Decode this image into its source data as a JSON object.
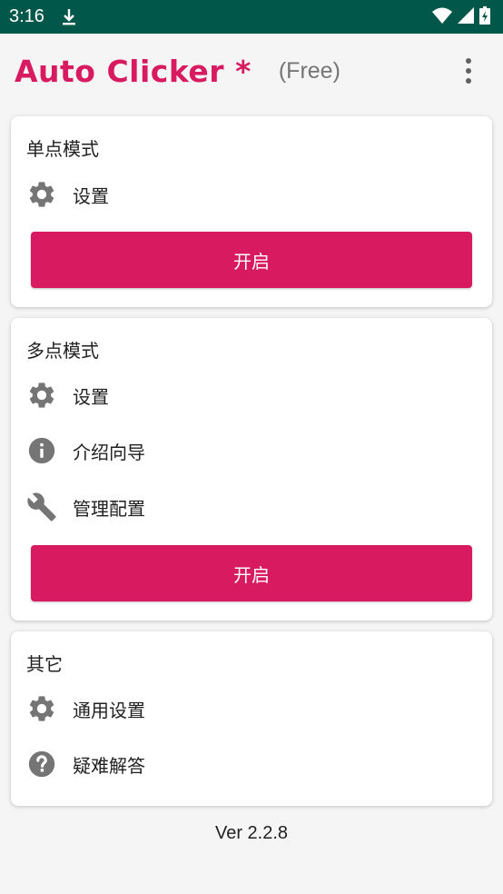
{
  "status_bar": {
    "time": "3:16",
    "icons": [
      "download-icon",
      "wifi-icon",
      "signal-icon",
      "battery-icon"
    ]
  },
  "app_bar": {
    "title": "Auto Clicker *",
    "subtitle": "(Free)",
    "menu_icon": "more-vert-icon"
  },
  "single_mode": {
    "title": "单点模式",
    "items": [
      {
        "icon": "gear-icon",
        "label": "设置"
      }
    ],
    "start_label": "开启"
  },
  "multi_mode": {
    "title": "多点模式",
    "items": [
      {
        "icon": "gear-icon",
        "label": "设置"
      },
      {
        "icon": "info-icon",
        "label": "介绍向导"
      },
      {
        "icon": "wrench-icon",
        "label": "管理配置"
      }
    ],
    "start_label": "开启"
  },
  "other": {
    "title": "其它",
    "items": [
      {
        "icon": "gear-icon",
        "label": "通用设置"
      },
      {
        "icon": "help-icon",
        "label": "疑难解答"
      }
    ]
  },
  "footer": {
    "version": "Ver 2.2.8"
  },
  "colors": {
    "accent": "#d81b60",
    "status_bar": "#02574b",
    "icon_grey": "#757575"
  }
}
